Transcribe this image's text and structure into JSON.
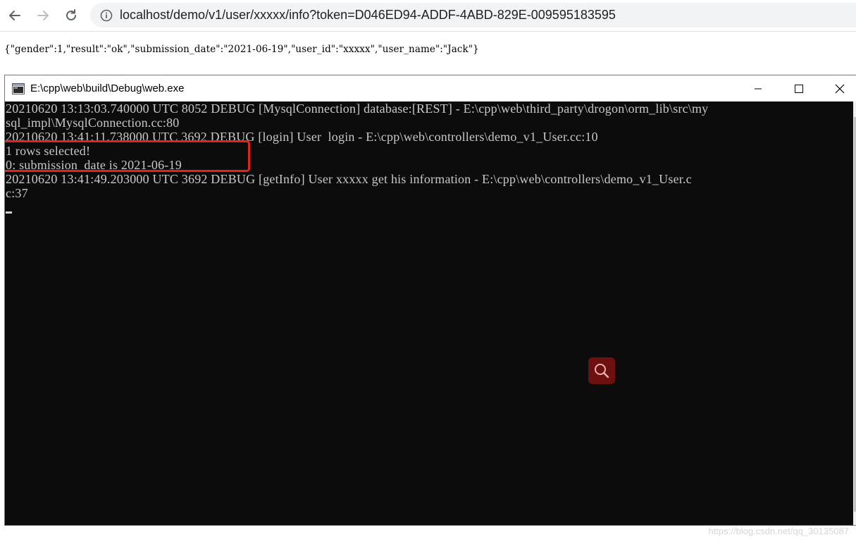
{
  "browser": {
    "url": "localhost/demo/v1/user/xxxxx/info?token=D046ED94-ADDF-4ABD-829E-009595183595"
  },
  "page": {
    "json_response": "{\"gender\":1,\"result\":\"ok\",\"submission_date\":\"2021-06-19\",\"user_id\":\"xxxxx\",\"user_name\":\"Jack\"}"
  },
  "console": {
    "title": "E:\\cpp\\web\\build\\Debug\\web.exe",
    "lines": [
      "20210620 13:13:03.740000 UTC 8052 DEBUG [MysqlConnection] database:[REST] - E:\\cpp\\web\\third_party\\drogon\\orm_lib\\src\\my",
      "sql_impl\\MysqlConnection.cc:80",
      "20210620 13:41:11.738000 UTC 3692 DEBUG [login] User  login - E:\\cpp\\web\\controllers\\demo_v1_User.cc:10",
      "1 rows selected!",
      "0: submission_date is 2021-06-19",
      "20210620 13:41:49.203000 UTC 3692 DEBUG [getInfo] User xxxxx get his information - E:\\cpp\\web\\controllers\\demo_v1_User.c",
      "c:37"
    ],
    "highlight_color": "#e3231c",
    "background_color": "#0c0c0c"
  },
  "watermark": "https://blog.csdn.net/qq_30135087"
}
